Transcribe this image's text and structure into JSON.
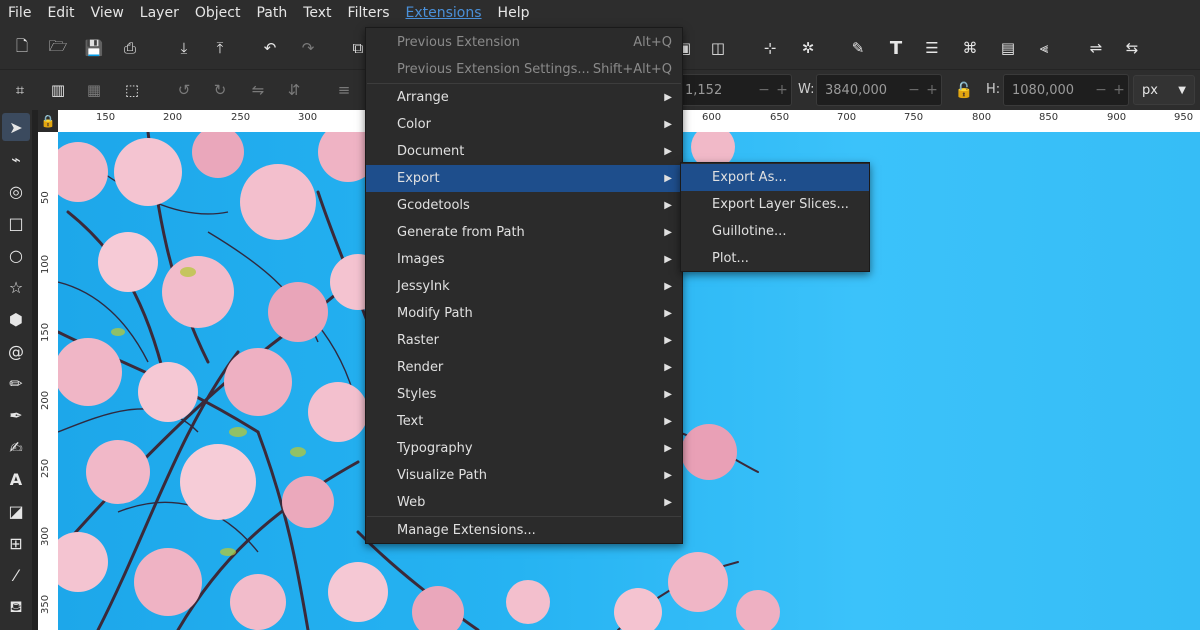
{
  "menubar": {
    "items": [
      "File",
      "Edit",
      "View",
      "Layer",
      "Object",
      "Path",
      "Text",
      "Filters",
      "Extensions",
      "Help"
    ]
  },
  "toolbar": {
    "x_value": "1,152",
    "w_label": "W:",
    "w_value": "3840,000",
    "h_label": "H:",
    "h_value": "1080,000",
    "unit": "px"
  },
  "ruler": {
    "h_labels": [
      "150",
      "200",
      "250",
      "300",
      "600",
      "650",
      "700",
      "750",
      "800",
      "850",
      "900",
      "950"
    ],
    "v_labels": [
      "50",
      "100",
      "150",
      "200",
      "250",
      "300",
      "350"
    ]
  },
  "extensions_menu": {
    "items": [
      {
        "label": "Previous Extension",
        "accel": "Alt+Q",
        "disabled": true
      },
      {
        "label": "Previous Extension Settings...",
        "accel": "Shift+Alt+Q",
        "disabled": true
      },
      {
        "label": "Arrange",
        "submenu": true
      },
      {
        "label": "Color",
        "submenu": true
      },
      {
        "label": "Document",
        "submenu": true
      },
      {
        "label": "Export",
        "submenu": true,
        "highlighted": true
      },
      {
        "label": "Gcodetools",
        "submenu": true
      },
      {
        "label": "Generate from Path",
        "submenu": true
      },
      {
        "label": "Images",
        "submenu": true
      },
      {
        "label": "JessyInk",
        "submenu": true
      },
      {
        "label": "Modify Path",
        "submenu": true
      },
      {
        "label": "Raster",
        "submenu": true
      },
      {
        "label": "Render",
        "submenu": true
      },
      {
        "label": "Styles",
        "submenu": true
      },
      {
        "label": "Text",
        "submenu": true
      },
      {
        "label": "Typography",
        "submenu": true
      },
      {
        "label": "Visualize Path",
        "submenu": true
      },
      {
        "label": "Web",
        "submenu": true
      },
      {
        "label": "Manage Extensions..."
      }
    ]
  },
  "export_submenu": {
    "items": [
      {
        "label": "Export As...",
        "highlighted": true
      },
      {
        "label": "Export Layer Slices..."
      },
      {
        "label": "Guillotine..."
      },
      {
        "label": "Plot..."
      }
    ]
  },
  "colors": {
    "highlight": "#1e4e8c",
    "menu_bg": "#2b2b2b",
    "sky": "#26b3f2",
    "active_menu": "#4a90d9"
  }
}
